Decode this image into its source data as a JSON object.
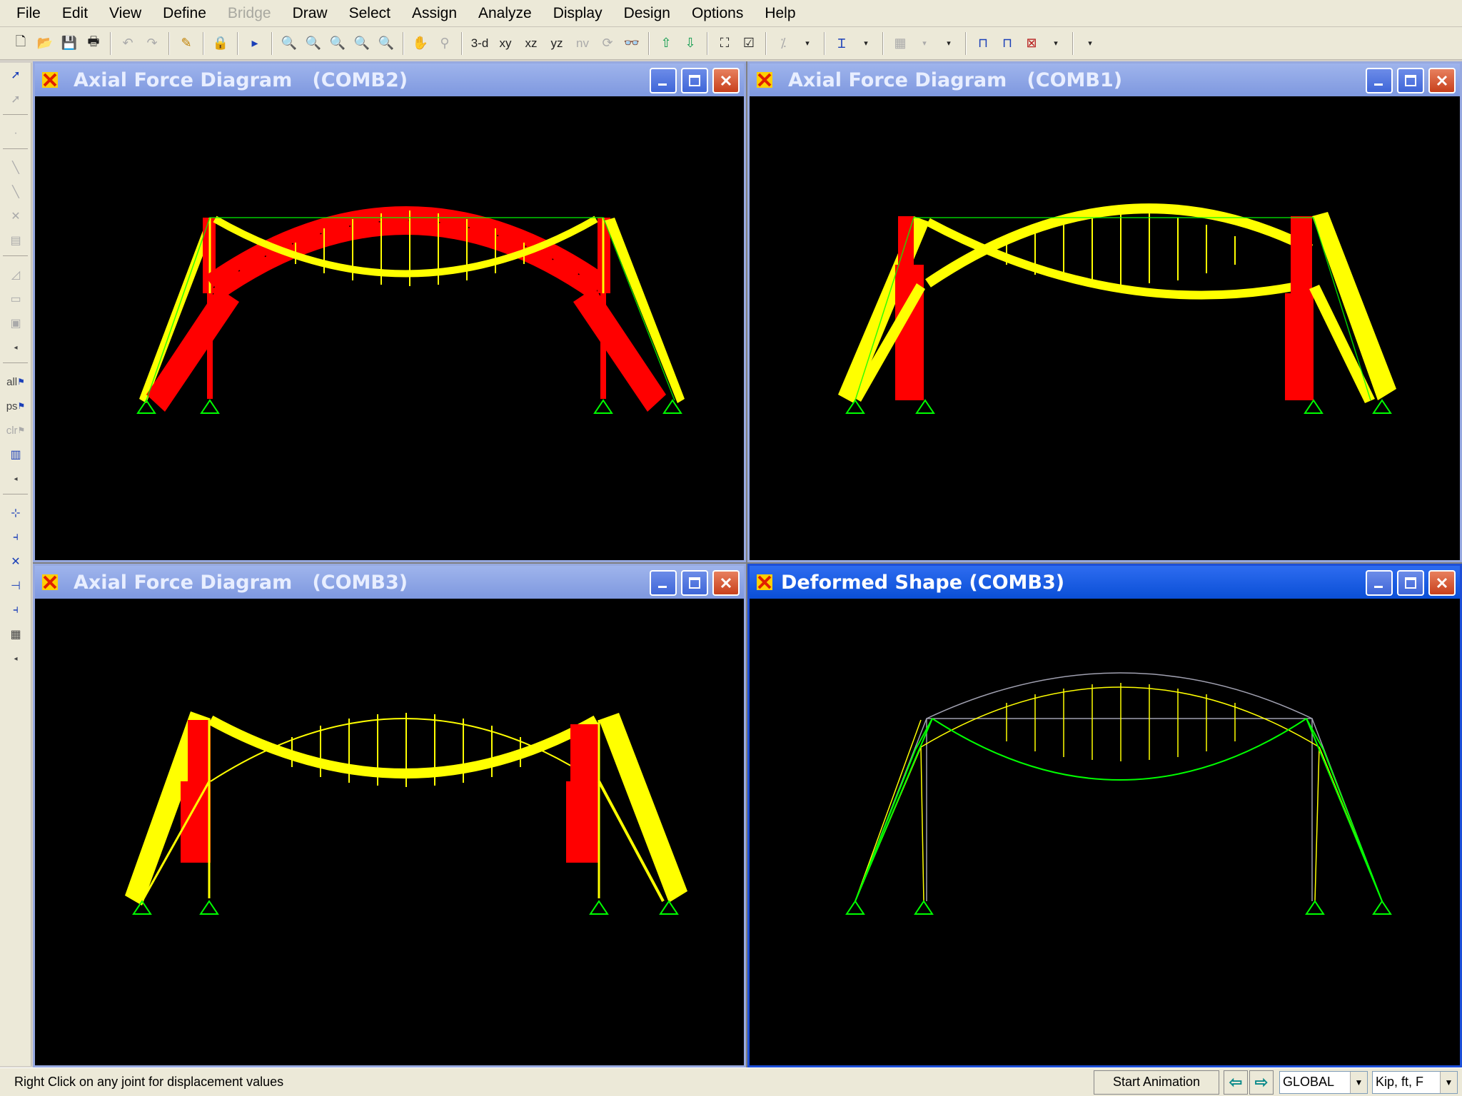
{
  "menubar": {
    "items": [
      "File",
      "Edit",
      "View",
      "Define",
      "Bridge",
      "Draw",
      "Select",
      "Assign",
      "Analyze",
      "Display",
      "Design",
      "Options",
      "Help"
    ]
  },
  "toolbar": {
    "view_3d": "3-d",
    "view_xy": "xy",
    "view_xz": "xz",
    "view_yz": "yz",
    "view_nv": "nv"
  },
  "sidebar": {
    "all_label": "all",
    "ps_label": "ps",
    "clr_label": "clr"
  },
  "windows": [
    {
      "id": "top-left",
      "title": "Axial Force Diagram   (COMB2)",
      "active": false
    },
    {
      "id": "top-right",
      "title": "Axial Force Diagram   (COMB1)",
      "active": false
    },
    {
      "id": "bottom-left",
      "title": "Axial Force Diagram   (COMB3)",
      "active": false
    },
    {
      "id": "bottom-right",
      "title": "Deformed Shape (COMB3)",
      "active": true
    }
  ],
  "statusbar": {
    "message": "Right Click on any joint for displacement values",
    "animation_button": "Start Animation",
    "coord_system": "GLOBAL",
    "units": "Kip, ft, F"
  },
  "colors": {
    "compression": "#ff0000",
    "tension": "#ffff00",
    "deformed": "#00ff00",
    "undeformed": "#a0a0b0",
    "supports": "#00ff00",
    "active_title": "#0a4fd6",
    "inactive_title": "#8aa2e4"
  }
}
